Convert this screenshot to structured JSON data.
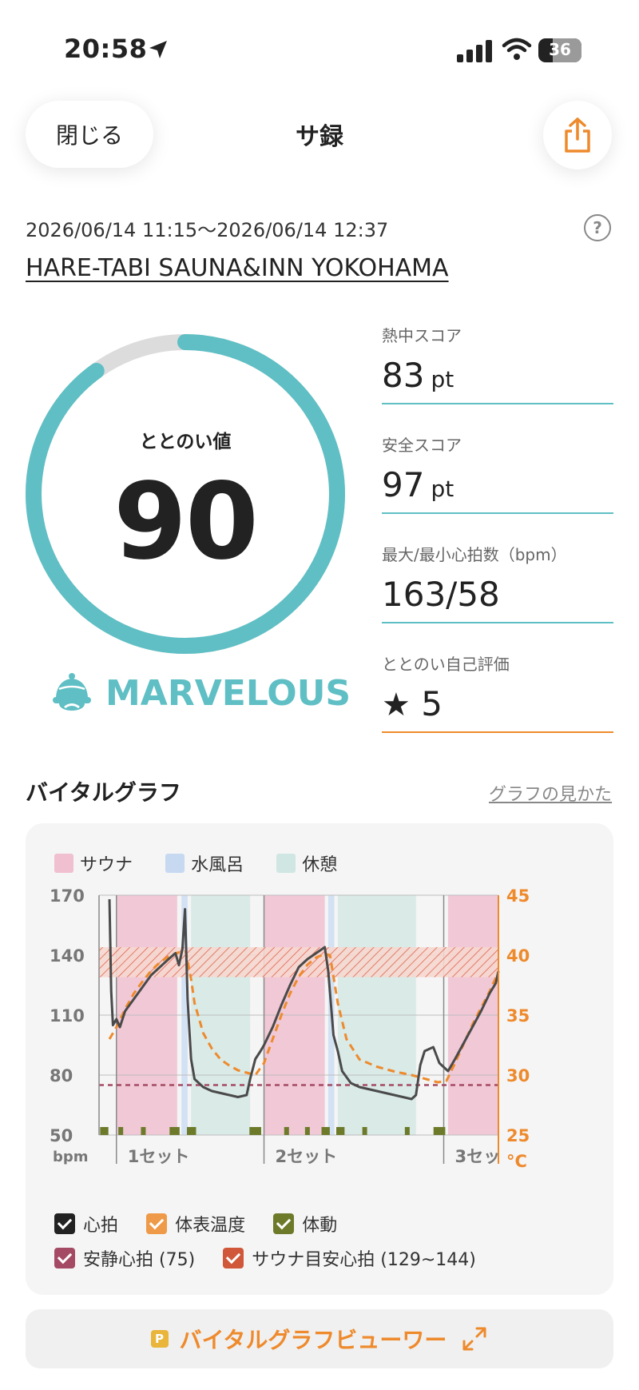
{
  "status_bar": {
    "time": "20:58",
    "battery": "36"
  },
  "header": {
    "close_label": "閉じる",
    "title": "サ録"
  },
  "session": {
    "datetime": "2026/06/14 11:15～2026/06/14 12:37",
    "facility": "HARE-TABI SAUNA&INN YOKOHAMA"
  },
  "totonoi": {
    "label": "ととのい値",
    "value": "90",
    "fraction": 0.9,
    "rank": "MARVELOUS"
  },
  "scores": [
    {
      "label": "熱中スコア",
      "value": "83",
      "unit": "pt"
    },
    {
      "label": "安全スコア",
      "value": "97",
      "unit": "pt"
    },
    {
      "label": "最大/最小心拍数（bpm）",
      "value": "163/58",
      "unit": ""
    },
    {
      "label": "ととのい自己評価",
      "value": "5",
      "unit": ""
    }
  ],
  "vital": {
    "title": "バイタルグラフ",
    "help_link": "グラフの見かた",
    "legend_top": [
      "サウナ",
      "水風呂",
      "休憩"
    ],
    "legend_bottom": [
      "心拍",
      "体表温度",
      "体動",
      "安静心拍 (75)",
      "サウナ目安心拍 (129~144)"
    ],
    "viewer_label": "バイタルグラフビューワー",
    "viewer_badge": "P"
  },
  "colors": {
    "teal": "#5fbfc4",
    "orange": "#ee8a2c",
    "sauna": "#f0bfd0",
    "cold": "#c6d9f1",
    "rest": "#cfe6e2",
    "rest_hr": "#a54a64",
    "target_hr": "#d0573a",
    "movement": "#6c7a2a"
  },
  "chart_data": {
    "type": "line",
    "y_left": {
      "label": "bpm",
      "ticks": [
        50,
        80,
        110,
        140,
        170
      ],
      "range": [
        50,
        170
      ]
    },
    "y_right": {
      "label": "°C",
      "ticks": [
        25,
        30,
        35,
        40,
        45
      ],
      "range": [
        25,
        45
      ]
    },
    "x_ticks": [
      "1セット",
      "2セット",
      "3セッ"
    ],
    "phases": [
      {
        "type": "sauna",
        "start": 2.0,
        "end": 9.0
      },
      {
        "type": "cold",
        "start": 9.5,
        "end": 10.2
      },
      {
        "type": "rest",
        "start": 10.6,
        "end": 17.4
      },
      {
        "type": "sauna",
        "start": 19.0,
        "end": 26.0
      },
      {
        "type": "cold",
        "start": 26.4,
        "end": 27.1
      },
      {
        "type": "rest",
        "start": 27.5,
        "end": 36.5
      },
      {
        "type": "sauna",
        "start": 40.2,
        "end": 46.0
      }
    ],
    "set_markers": [
      2.0,
      19.0,
      39.7
    ],
    "target_hr_band": [
      129,
      144
    ],
    "rest_hr": 75,
    "series": [
      {
        "name": "心拍",
        "points": [
          [
            1.2,
            168
          ],
          [
            1.4,
            122
          ],
          [
            1.6,
            105
          ],
          [
            2.0,
            108
          ],
          [
            2.4,
            104
          ],
          [
            3.0,
            112
          ],
          [
            4.0,
            118
          ],
          [
            5.0,
            124
          ],
          [
            6.0,
            130
          ],
          [
            7.0,
            134
          ],
          [
            8.0,
            138
          ],
          [
            8.8,
            141
          ],
          [
            9.2,
            135
          ],
          [
            9.6,
            143
          ],
          [
            9.9,
            163
          ],
          [
            10.2,
            118
          ],
          [
            10.6,
            88
          ],
          [
            11.0,
            78
          ],
          [
            12.0,
            74
          ],
          [
            13.0,
            72
          ],
          [
            14.0,
            71
          ],
          [
            15.0,
            70
          ],
          [
            16.0,
            69
          ],
          [
            17.0,
            70
          ],
          [
            17.4,
            78
          ],
          [
            18.0,
            88
          ],
          [
            18.6,
            92
          ],
          [
            19.0,
            95
          ],
          [
            20.0,
            104
          ],
          [
            21.0,
            115
          ],
          [
            22.0,
            125
          ],
          [
            23.0,
            134
          ],
          [
            24.0,
            138
          ],
          [
            25.0,
            141
          ],
          [
            26.0,
            144
          ],
          [
            26.4,
            132
          ],
          [
            27.0,
            100
          ],
          [
            27.5,
            92
          ],
          [
            28.0,
            82
          ],
          [
            29.0,
            76
          ],
          [
            30.0,
            74
          ],
          [
            31.0,
            73
          ],
          [
            32.0,
            72
          ],
          [
            33.0,
            71
          ],
          [
            34.0,
            70
          ],
          [
            35.0,
            69
          ],
          [
            36.0,
            68
          ],
          [
            36.5,
            70
          ],
          [
            37.0,
            85
          ],
          [
            37.5,
            92
          ],
          [
            38.5,
            94
          ],
          [
            39.2,
            86
          ],
          [
            40.2,
            82
          ],
          [
            41.0,
            88
          ],
          [
            42.0,
            96
          ],
          [
            43.0,
            104
          ],
          [
            44.0,
            112
          ],
          [
            45.0,
            121
          ],
          [
            45.7,
            126
          ],
          [
            46.0,
            132
          ]
        ]
      },
      {
        "name": "体表温度",
        "points": [
          [
            1.2,
            33
          ],
          [
            2.0,
            34
          ],
          [
            3.0,
            35.5
          ],
          [
            4.0,
            36.8
          ],
          [
            5.0,
            37.8
          ],
          [
            6.0,
            38.7
          ],
          [
            7.0,
            39.4
          ],
          [
            8.0,
            39.9
          ],
          [
            9.0,
            40.2
          ],
          [
            10.0,
            40.3
          ],
          [
            10.6,
            38
          ],
          [
            11.0,
            36
          ],
          [
            12.0,
            33.5
          ],
          [
            13.0,
            32.2
          ],
          [
            14.0,
            31.3
          ],
          [
            15.0,
            30.8
          ],
          [
            16.0,
            30.4
          ],
          [
            17.0,
            30.2
          ],
          [
            18.0,
            30
          ],
          [
            19.0,
            31
          ],
          [
            20.0,
            33
          ],
          [
            21.0,
            35
          ],
          [
            22.0,
            36.8
          ],
          [
            23.0,
            38.2
          ],
          [
            24.0,
            39.2
          ],
          [
            25.0,
            39.8
          ],
          [
            26.0,
            40.1
          ],
          [
            26.6,
            40
          ],
          [
            27.5,
            36
          ],
          [
            28.5,
            33
          ],
          [
            30.0,
            31.3
          ],
          [
            32.0,
            30.7
          ],
          [
            34.0,
            30.3
          ],
          [
            36.0,
            30
          ],
          [
            37.0,
            29.8
          ],
          [
            38.0,
            29.6
          ],
          [
            39.0,
            29.4
          ],
          [
            40.0,
            29.5
          ],
          [
            41.0,
            31
          ],
          [
            42.0,
            32.6
          ],
          [
            43.0,
            34.2
          ],
          [
            44.0,
            35.6
          ],
          [
            45.0,
            37
          ],
          [
            46.0,
            38.6
          ]
        ]
      }
    ]
  }
}
